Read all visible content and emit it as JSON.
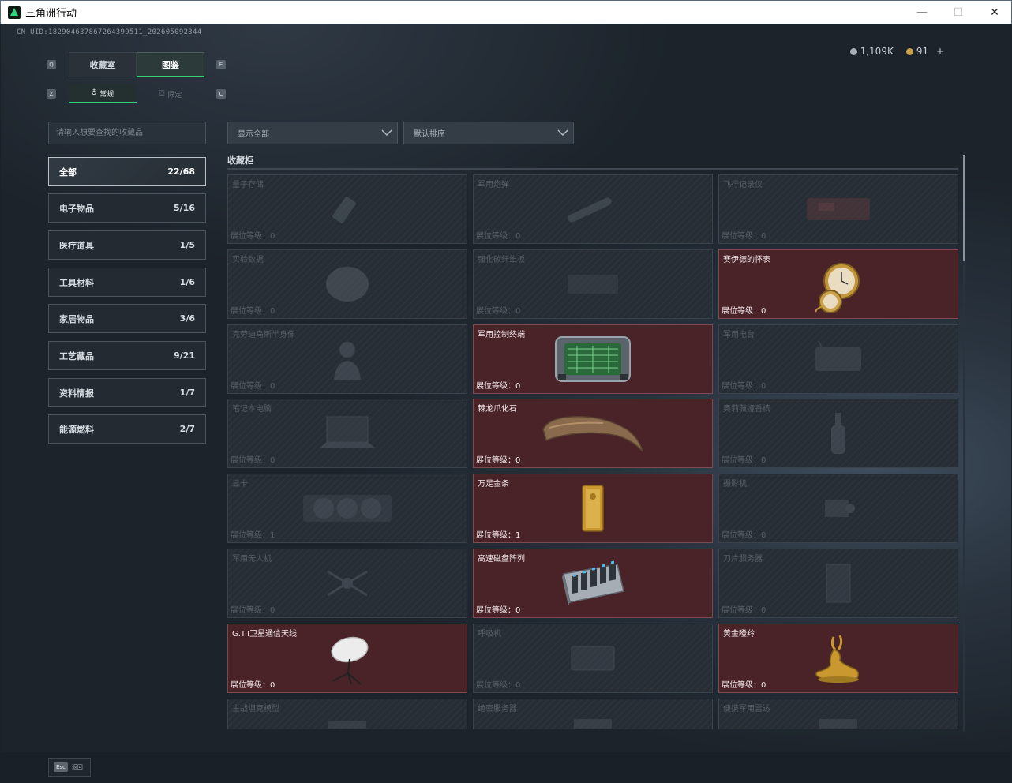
{
  "window": {
    "title": "三角洲行动",
    "minimize": "—",
    "maximize": "☐",
    "close": "✕"
  },
  "uid_text": "CN UID:18290463786726439951​1_202605092344",
  "currency": {
    "coins": "1,109K",
    "gold": "91",
    "add": "+"
  },
  "top_tabs": [
    {
      "label": "收藏室",
      "key": "Q",
      "active": false
    },
    {
      "label": "图鉴",
      "key": "E",
      "active": true
    }
  ],
  "sub_tabs": [
    {
      "label": "常规",
      "key": "Z",
      "active": true
    },
    {
      "label": "限定",
      "key": "C",
      "active": false
    }
  ],
  "search": {
    "placeholder": "请输入想要查找的收藏品",
    "value": ""
  },
  "dropdowns": {
    "filter": "显示全部",
    "sort": "默认排序"
  },
  "categories": [
    {
      "label": "全部",
      "count": "22/68",
      "active": true
    },
    {
      "label": "电子物品",
      "count": "5/16"
    },
    {
      "label": "医疗道具",
      "count": "1/5"
    },
    {
      "label": "工具材料",
      "count": "1/6"
    },
    {
      "label": "家居物品",
      "count": "3/6"
    },
    {
      "label": "工艺藏品",
      "count": "9/21"
    },
    {
      "label": "资料情报",
      "count": "1/7"
    },
    {
      "label": "能源燃料",
      "count": "2/7"
    }
  ],
  "section_title": "收藏柜",
  "cards": [
    {
      "name": "量子存储",
      "level": "展位等级：0",
      "owned": false,
      "icon": "usb-drive-icon"
    },
    {
      "name": "军用炮弹",
      "level": "展位等级：0",
      "owned": false,
      "icon": "artillery-shell-icon"
    },
    {
      "name": "飞行记录仪",
      "level": "展位等级：0",
      "owned": false,
      "icon": "flight-recorder-icon"
    },
    {
      "name": "实验数据",
      "level": "展位等级：0",
      "owned": false,
      "icon": "data-disc-icon"
    },
    {
      "name": "强化碳纤维板",
      "level": "展位等级：0",
      "owned": false,
      "icon": "carbon-plate-icon"
    },
    {
      "name": "赛伊德的怀表",
      "level": "展位等级：0",
      "owned": true,
      "icon": "pocket-watch-icon"
    },
    {
      "name": "克劳迪乌斯半身像",
      "level": "展位等级：0",
      "owned": false,
      "icon": "bust-icon"
    },
    {
      "name": "军用控制终端",
      "level": "展位等级：0",
      "owned": true,
      "icon": "control-terminal-icon"
    },
    {
      "name": "军用电台",
      "level": "展位等级：0",
      "owned": false,
      "icon": "radio-icon"
    },
    {
      "name": "笔记本电脑",
      "level": "展位等级：0",
      "owned": false,
      "icon": "laptop-icon"
    },
    {
      "name": "棘龙爪化石",
      "level": "展位等级：0",
      "owned": true,
      "icon": "claw-fossil-icon"
    },
    {
      "name": "奥莉薇娅香槟",
      "level": "展位等级：0",
      "owned": false,
      "icon": "champagne-icon"
    },
    {
      "name": "显卡",
      "level": "展位等级：1",
      "owned": false,
      "icon": "graphics-card-icon"
    },
    {
      "name": "万足金条",
      "level": "展位等级：1",
      "owned": true,
      "icon": "gold-bar-icon"
    },
    {
      "name": "摄影机",
      "level": "展位等级：0",
      "owned": false,
      "icon": "camera-icon"
    },
    {
      "name": "军用无人机",
      "level": "展位等级：0",
      "owned": false,
      "icon": "drone-icon"
    },
    {
      "name": "高速磁盘阵列",
      "level": "展位等级：0",
      "owned": true,
      "icon": "disk-array-icon"
    },
    {
      "name": "刀片服务器",
      "level": "展位等级：0",
      "owned": false,
      "icon": "blade-server-icon"
    },
    {
      "name": "G.T.I卫星通信天线",
      "level": "展位等级：0",
      "owned": true,
      "icon": "satellite-dish-icon"
    },
    {
      "name": "呼吸机",
      "level": "展位等级：0",
      "owned": false,
      "icon": "ventilator-icon"
    },
    {
      "name": "黄金瞪羚",
      "level": "展位等级：0",
      "owned": true,
      "icon": "golden-gazelle-icon"
    },
    {
      "name": "主战坦克模型",
      "level": "",
      "owned": false,
      "icon": "tank-model-icon"
    },
    {
      "name": "绝密服务器",
      "level": "",
      "owned": false,
      "icon": "secret-server-icon"
    },
    {
      "name": "便携军用雷达",
      "level": "",
      "owned": false,
      "icon": "portable-radar-icon"
    }
  ],
  "bottom": {
    "esc_key": "Esc",
    "esc_label": "返回"
  },
  "colors": {
    "owned_bg": "#4a2329",
    "active_tab_accent": "#2fd67e",
    "unowned_bg": "#262d35"
  }
}
